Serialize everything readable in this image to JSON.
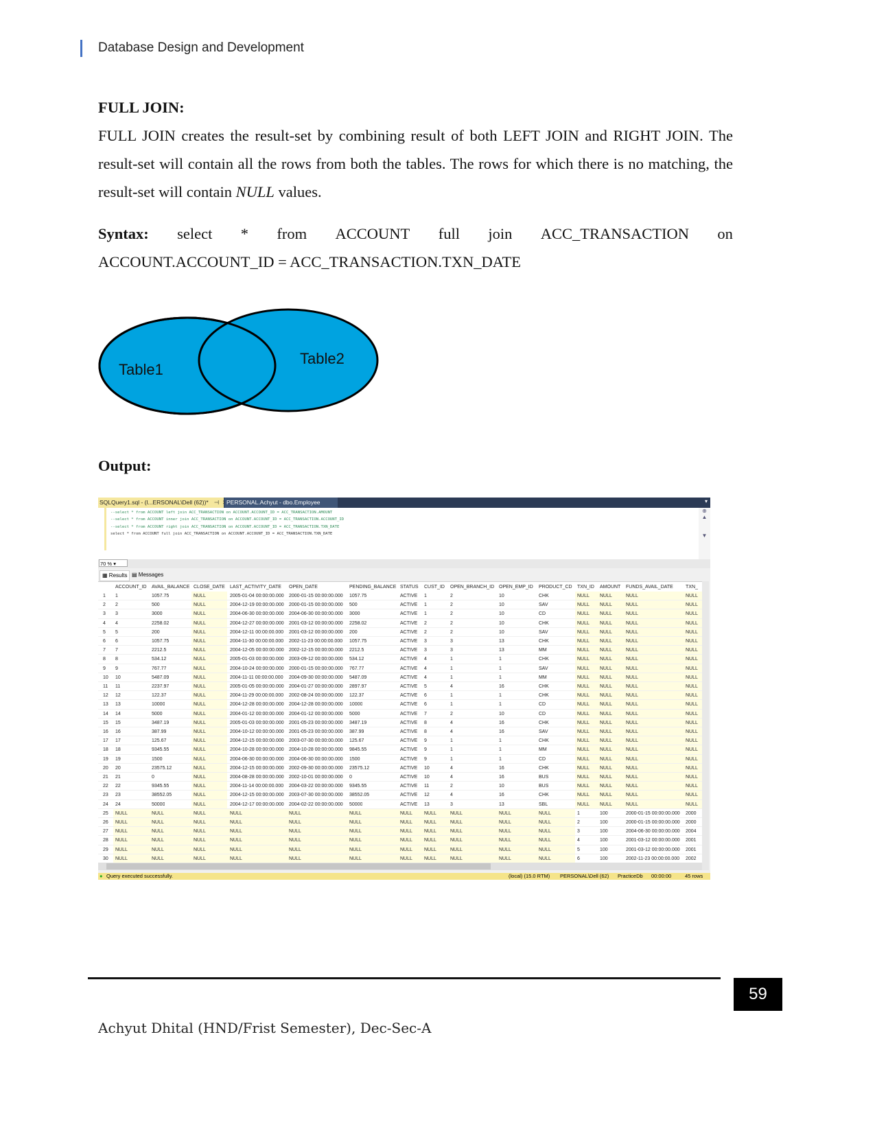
{
  "header": {
    "title": "Database Design and Development"
  },
  "section": {
    "heading": "FULL JOIN:",
    "para_before": " FULL JOIN creates the result-set by combining result of both LEFT JOIN and RIGHT JOIN. The result-set will contain all the rows from both the tables. The rows for which there is no matching, the result-set will contain ",
    "para_null": "NULL",
    "para_after": " values.",
    "syntax_label": "Syntax:",
    "syntax_words": [
      "select",
      "*",
      "from",
      "ACCOUNT",
      "full",
      "join",
      "ACC_TRANSACTION",
      "on"
    ],
    "syntax_line2": "ACCOUNT.ACCOUNT_ID = ACC_TRANSACTION.TXN_DATE",
    "output_label": "Output:"
  },
  "venn": {
    "left_label": "Table1",
    "right_label": "Table2",
    "fill": "#00a3e0",
    "stroke": "#000000"
  },
  "ssms": {
    "active_tab": "SQLQuery1.sql - (l...ERSONAL\\Dell (62))*",
    "pin_icon": "pin-icon",
    "close_icon": "close-icon",
    "other_tab": "PERSONAL.Achyut - dbo.Employee",
    "code_lines": [
      {
        "text": "--select * from ACCOUNT left join ACC_TRANSACTION on ACCOUNT.ACCOUNT_ID = ACC_TRANSACTION.AMOUNT",
        "comment": true
      },
      {
        "text": "--select * from ACCOUNT inner join ACC_TRANSACTION on ACCOUNT.ACCOUNT_ID = ACC_TRANSACTION.ACCOUNT_ID",
        "comment": true
      },
      {
        "text": "--select * from ACCOUNT right join ACC_TRANSACTION on ACCOUNT.ACCOUNT_ID = ACC_TRANSACTION.TXN_DATE",
        "comment": true
      },
      {
        "text": "select * from ACCOUNT full join ACC_TRANSACTION on ACCOUNT.ACCOUNT_ID = ACC_TRANSACTION.TXN_DATE",
        "comment": false
      }
    ],
    "zoom": "70 %",
    "results_tab": "Results",
    "messages_tab": "Messages",
    "columns": [
      "",
      "ACCOUNT_ID",
      "AVAIL_BALANCE",
      "CLOSE_DATE",
      "LAST_ACTIVITY_DATE",
      "OPEN_DATE",
      "PENDING_BALANCE",
      "STATUS",
      "CUST_ID",
      "OPEN_BRANCH_ID",
      "OPEN_EMP_ID",
      "PRODUCT_CD",
      "TXN_ID",
      "AMOUNT",
      "FUNDS_AVAIL_DATE",
      "TXN_"
    ],
    "rows": [
      [
        "1",
        "1",
        "1057.75",
        "NULL",
        "2005-01-04 00:00:00.000",
        "2000-01-15 00:00:00.000",
        "1057.75",
        "ACTIVE",
        "1",
        "2",
        "10",
        "CHK",
        "NULL",
        "NULL",
        "NULL",
        "NULL"
      ],
      [
        "2",
        "2",
        "500",
        "NULL",
        "2004-12-19 00:00:00.000",
        "2000-01-15 00:00:00.000",
        "500",
        "ACTIVE",
        "1",
        "2",
        "10",
        "SAV",
        "NULL",
        "NULL",
        "NULL",
        "NULL"
      ],
      [
        "3",
        "3",
        "3000",
        "NULL",
        "2004-06-30 00:00:00.000",
        "2004-06-30 00:00:00.000",
        "3000",
        "ACTIVE",
        "1",
        "2",
        "10",
        "CD",
        "NULL",
        "NULL",
        "NULL",
        "NULL"
      ],
      [
        "4",
        "4",
        "2258.02",
        "NULL",
        "2004-12-27 00:00:00.000",
        "2001-03-12 00:00:00.000",
        "2258.02",
        "ACTIVE",
        "2",
        "2",
        "10",
        "CHK",
        "NULL",
        "NULL",
        "NULL",
        "NULL"
      ],
      [
        "5",
        "5",
        "200",
        "NULL",
        "2004-12-11 00:00:00.000",
        "2001-03-12 00:00:00.000",
        "200",
        "ACTIVE",
        "2",
        "2",
        "10",
        "SAV",
        "NULL",
        "NULL",
        "NULL",
        "NULL"
      ],
      [
        "6",
        "6",
        "1057.75",
        "NULL",
        "2004-11-30 00:00:00.000",
        "2002-11-23 00:00:00.000",
        "1057.75",
        "ACTIVE",
        "3",
        "3",
        "13",
        "CHK",
        "NULL",
        "NULL",
        "NULL",
        "NULL"
      ],
      [
        "7",
        "7",
        "2212.5",
        "NULL",
        "2004-12-05 00:00:00.000",
        "2002-12-15 00:00:00.000",
        "2212.5",
        "ACTIVE",
        "3",
        "3",
        "13",
        "MM",
        "NULL",
        "NULL",
        "NULL",
        "NULL"
      ],
      [
        "8",
        "8",
        "534.12",
        "NULL",
        "2005-01-03 00:00:00.000",
        "2003-09-12 00:00:00.000",
        "534.12",
        "ACTIVE",
        "4",
        "1",
        "1",
        "CHK",
        "NULL",
        "NULL",
        "NULL",
        "NULL"
      ],
      [
        "9",
        "9",
        "767.77",
        "NULL",
        "2004-10-24 00:00:00.000",
        "2000-01-15 00:00:00.000",
        "767.77",
        "ACTIVE",
        "4",
        "1",
        "1",
        "SAV",
        "NULL",
        "NULL",
        "NULL",
        "NULL"
      ],
      [
        "10",
        "10",
        "5487.09",
        "NULL",
        "2004-11-11 00:00:00.000",
        "2004-09-30 00:00:00.000",
        "5487.09",
        "ACTIVE",
        "4",
        "1",
        "1",
        "MM",
        "NULL",
        "NULL",
        "NULL",
        "NULL"
      ],
      [
        "11",
        "11",
        "2237.97",
        "NULL",
        "2005-01-05 00:00:00.000",
        "2004-01-27 00:00:00.000",
        "2897.97",
        "ACTIVE",
        "5",
        "4",
        "16",
        "CHK",
        "NULL",
        "NULL",
        "NULL",
        "NULL"
      ],
      [
        "12",
        "12",
        "122.37",
        "NULL",
        "2004-11-29 00:00:00.000",
        "2002-08-24 00:00:00.000",
        "122.37",
        "ACTIVE",
        "6",
        "1",
        "1",
        "CHK",
        "NULL",
        "NULL",
        "NULL",
        "NULL"
      ],
      [
        "13",
        "13",
        "10000",
        "NULL",
        "2004-12-28 00:00:00.000",
        "2004-12-28 00:00:00.000",
        "10000",
        "ACTIVE",
        "6",
        "1",
        "1",
        "CD",
        "NULL",
        "NULL",
        "NULL",
        "NULL"
      ],
      [
        "14",
        "14",
        "5000",
        "NULL",
        "2004-01-12 00:00:00.000",
        "2004-01-12 00:00:00.000",
        "5000",
        "ACTIVE",
        "7",
        "2",
        "10",
        "CD",
        "NULL",
        "NULL",
        "NULL",
        "NULL"
      ],
      [
        "15",
        "15",
        "3487.19",
        "NULL",
        "2005-01-03 00:00:00.000",
        "2001-05-23 00:00:00.000",
        "3487.19",
        "ACTIVE",
        "8",
        "4",
        "16",
        "CHK",
        "NULL",
        "NULL",
        "NULL",
        "NULL"
      ],
      [
        "16",
        "16",
        "387.99",
        "NULL",
        "2004-10-12 00:00:00.000",
        "2001-05-23 00:00:00.000",
        "387.99",
        "ACTIVE",
        "8",
        "4",
        "16",
        "SAV",
        "NULL",
        "NULL",
        "NULL",
        "NULL"
      ],
      [
        "17",
        "17",
        "125.67",
        "NULL",
        "2004-12-15 00:00:00.000",
        "2003-07-30 00:00:00.000",
        "125.67",
        "ACTIVE",
        "9",
        "1",
        "1",
        "CHK",
        "NULL",
        "NULL",
        "NULL",
        "NULL"
      ],
      [
        "18",
        "18",
        "9345.55",
        "NULL",
        "2004-10-28 00:00:00.000",
        "2004-10-28 00:00:00.000",
        "9845.55",
        "ACTIVE",
        "9",
        "1",
        "1",
        "MM",
        "NULL",
        "NULL",
        "NULL",
        "NULL"
      ],
      [
        "19",
        "19",
        "1500",
        "NULL",
        "2004-06-30 00:00:00.000",
        "2004-06-30 00:00:00.000",
        "1500",
        "ACTIVE",
        "9",
        "1",
        "1",
        "CD",
        "NULL",
        "NULL",
        "NULL",
        "NULL"
      ],
      [
        "20",
        "20",
        "23575.12",
        "NULL",
        "2004-12-15 00:00:00.000",
        "2002-09-30 00:00:00.000",
        "23575.12",
        "ACTIVE",
        "10",
        "4",
        "16",
        "CHK",
        "NULL",
        "NULL",
        "NULL",
        "NULL"
      ],
      [
        "21",
        "21",
        "0",
        "NULL",
        "2004-08-28 00:00:00.000",
        "2002-10-01 00:00:00.000",
        "0",
        "ACTIVE",
        "10",
        "4",
        "16",
        "BUS",
        "NULL",
        "NULL",
        "NULL",
        "NULL"
      ],
      [
        "22",
        "22",
        "9345.55",
        "NULL",
        "2004-11-14 00:00:00.000",
        "2004-03-22 00:00:00.000",
        "9345.55",
        "ACTIVE",
        "11",
        "2",
        "10",
        "BUS",
        "NULL",
        "NULL",
        "NULL",
        "NULL"
      ],
      [
        "23",
        "23",
        "38552.05",
        "NULL",
        "2004-12-15 00:00:00.000",
        "2003-07-30 00:00:00.000",
        "38552.05",
        "ACTIVE",
        "12",
        "4",
        "16",
        "CHK",
        "NULL",
        "NULL",
        "NULL",
        "NULL"
      ],
      [
        "24",
        "24",
        "50000",
        "NULL",
        "2004-12-17 00:00:00.000",
        "2004-02-22 00:00:00.000",
        "50000",
        "ACTIVE",
        "13",
        "3",
        "13",
        "SBL",
        "NULL",
        "NULL",
        "NULL",
        "NULL"
      ],
      [
        "25",
        "NULL",
        "NULL",
        "NULL",
        "NULL",
        "NULL",
        "NULL",
        "NULL",
        "NULL",
        "NULL",
        "NULL",
        "NULL",
        "1",
        "100",
        "2000-01-15 00:00:00.000",
        "2000"
      ],
      [
        "26",
        "NULL",
        "NULL",
        "NULL",
        "NULL",
        "NULL",
        "NULL",
        "NULL",
        "NULL",
        "NULL",
        "NULL",
        "NULL",
        "2",
        "100",
        "2000-01-15 00:00:00.000",
        "2000"
      ],
      [
        "27",
        "NULL",
        "NULL",
        "NULL",
        "NULL",
        "NULL",
        "NULL",
        "NULL",
        "NULL",
        "NULL",
        "NULL",
        "NULL",
        "3",
        "100",
        "2004-06-30 00:00:00.000",
        "2004"
      ],
      [
        "28",
        "NULL",
        "NULL",
        "NULL",
        "NULL",
        "NULL",
        "NULL",
        "NULL",
        "NULL",
        "NULL",
        "NULL",
        "NULL",
        "4",
        "100",
        "2001-03-12 00:00:00.000",
        "2001"
      ],
      [
        "29",
        "NULL",
        "NULL",
        "NULL",
        "NULL",
        "NULL",
        "NULL",
        "NULL",
        "NULL",
        "NULL",
        "NULL",
        "NULL",
        "5",
        "100",
        "2001-03-12 00:00:00.000",
        "2001"
      ],
      [
        "30",
        "NULL",
        "NULL",
        "NULL",
        "NULL",
        "NULL",
        "NULL",
        "NULL",
        "NULL",
        "NULL",
        "NULL",
        "NULL",
        "6",
        "100",
        "2002-11-23 00:00:00.000",
        "2002"
      ]
    ],
    "status": {
      "message": "Query executed successfully.",
      "server": "(local) (15.0 RTM)",
      "user": "PERSONAL\\Dell (62)",
      "database": "PracticeDb",
      "time": "00:00:00",
      "rows": "45 rows"
    },
    "colors": {
      "tab_active": "#f5e79e",
      "tabbar": "#2b3a55",
      "null_cell": "#fffde0",
      "status_bar": "#f5e48a"
    }
  },
  "footer": {
    "page_number": "59",
    "author": "Achyut Dhital (HND/Frist Semester), Dec-Sec-A"
  }
}
